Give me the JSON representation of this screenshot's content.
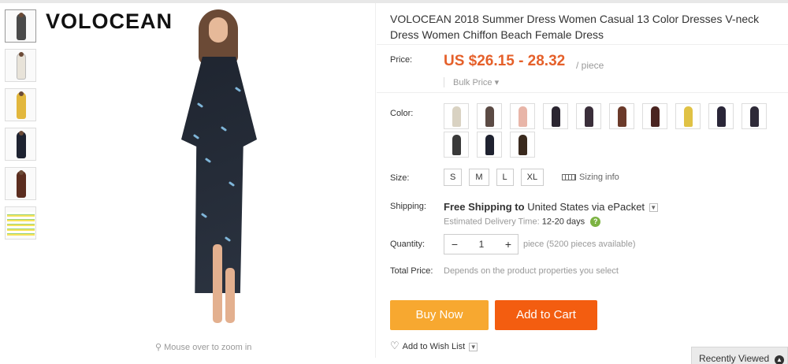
{
  "thumbnails": [
    {
      "name": "thumb-1",
      "color": "#4a4a4a"
    },
    {
      "name": "thumb-2",
      "color": "#e8e3d9"
    },
    {
      "name": "thumb-3",
      "color": "#e2b73d"
    },
    {
      "name": "thumb-4",
      "color": "#1d2230"
    },
    {
      "name": "thumb-5",
      "color": "#5b2d1f"
    },
    {
      "name": "thumb-size-chart",
      "color": "#f7e35a"
    }
  ],
  "main_image": {
    "brand": "VOLOCEAN",
    "zoom_hint": "Mouse over to zoom in",
    "zoom_icon": "magnifier-icon"
  },
  "product": {
    "title": "VOLOCEAN 2018 Summer Dress Women Casual 13 Color Dresses V-neck Dress Women Chiffon Beach Female Dress",
    "price_label": "Price:",
    "price": "US $26.15 - 28.32",
    "per_unit": "/ piece",
    "bulk_price": "Bulk Price",
    "color_label": "Color:",
    "colors": [
      "#d9d2c2",
      "#5b4a44",
      "#e8b5a8",
      "#2a2530",
      "#3a2e3a",
      "#6b3a2a",
      "#4a2420",
      "#e0c245",
      "#2a2638",
      "#2e2a38",
      "#3a3a3a",
      "#1f2230",
      "#3a2a1e"
    ],
    "size_label": "Size:",
    "sizes": [
      "S",
      "M",
      "L",
      "XL"
    ],
    "sizing_info": "Sizing info",
    "shipping_label": "Shipping:",
    "free_shipping": "Free Shipping to",
    "ship_dest": "United States via ePacket",
    "estimated_label": "Estimated Delivery Time:",
    "estimated_days": "12-20 days",
    "quantity_label": "Quantity:",
    "quantity": "1",
    "minus": "−",
    "plus": "+",
    "availability": "piece (5200 pieces available)",
    "total_label": "Total Price:",
    "total_text": "Depends on the product properties you select",
    "buy_now": "Buy Now",
    "add_to_cart": "Add to Cart",
    "wish_list": "Add to Wish List"
  },
  "colors": {
    "price": "#e5602a",
    "buy_now_bg": "#f7a830",
    "add_to_cart_bg": "#f35d10"
  },
  "recently_viewed": "Recently Viewed"
}
